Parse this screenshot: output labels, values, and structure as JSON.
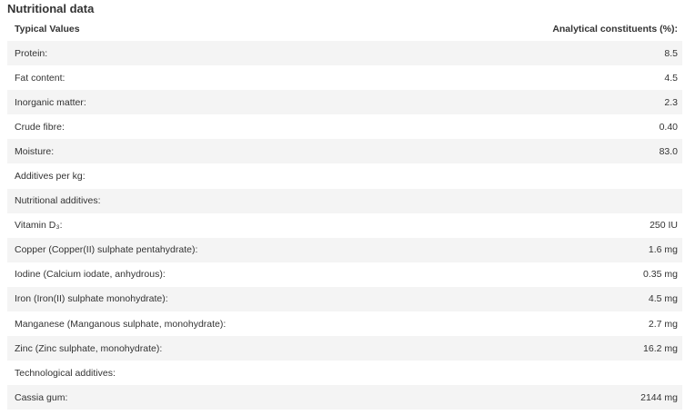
{
  "title": "Nutritional data",
  "header": {
    "left": "Typical Values",
    "right": "Analytical constituents (%):"
  },
  "rows": [
    {
      "label": "Protein:",
      "value": "8.5"
    },
    {
      "label": "Fat content:",
      "value": "4.5"
    },
    {
      "label": "Inorganic matter:",
      "value": "2.3"
    },
    {
      "label": "Crude fibre:",
      "value": "0.40"
    },
    {
      "label": "Moisture:",
      "value": "83.0"
    },
    {
      "label": "Additives per kg:",
      "value": ""
    },
    {
      "label": "Nutritional additives:",
      "value": ""
    },
    {
      "label": "Vitamin D₃:",
      "value": "250 IU"
    },
    {
      "label": "Copper (Copper(II) sulphate pentahydrate):",
      "value": "1.6 mg"
    },
    {
      "label": "Iodine (Calcium iodate, anhydrous):",
      "value": "0.35 mg"
    },
    {
      "label": "Iron (Iron(II) sulphate monohydrate):",
      "value": "4.5 mg"
    },
    {
      "label": "Manganese (Manganous sulphate, monohydrate):",
      "value": "2.7 mg"
    },
    {
      "label": "Zinc (Zinc sulphate, monohydrate):",
      "value": "16.2 mg"
    },
    {
      "label": "Technological additives:",
      "value": ""
    },
    {
      "label": "Cassia gum:",
      "value": "2144 mg"
    }
  ]
}
